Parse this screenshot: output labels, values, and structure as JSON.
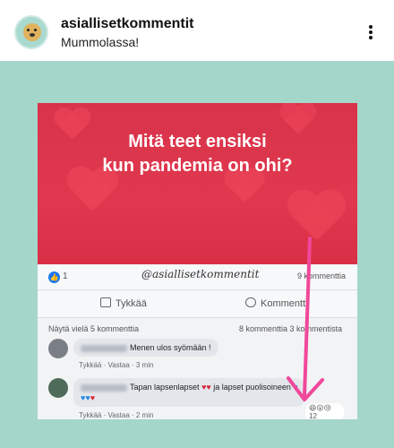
{
  "header": {
    "username": "asiallisetkommentit",
    "caption": "Mummolassa!",
    "avatar_icon": "dog-avatar",
    "more_icon": "more-vertical-icon"
  },
  "colors": {
    "background": "#a4d6c9",
    "banner_red": "#d8334a",
    "arrow_pink": "#f0489a",
    "facebook_blue": "#1877f2"
  },
  "fb_post": {
    "banner_line1": "Mitä teet ensiksi",
    "banner_line2": "kun pandemia on ohi?",
    "like_count": "1",
    "watermark": "@asiallisetkommentit",
    "comments_count": "9 kommenttia",
    "like_button": "Tykkää",
    "comment_button": "Kommentti",
    "more_comments": "Näytä vielä 5 kommenttia",
    "comments_of": "8 kommenttia 3 kommentista",
    "comments": [
      {
        "text": "Menen ulos syömään !",
        "like": "Tykkää",
        "reply": "Vastaa",
        "time": "3 min"
      },
      {
        "text_before": "Tapan lapsenlapset",
        "text_middle": "ja lapset puolisoineen",
        "like": "Tykkää",
        "reply": "Vastaa",
        "time": "2 min",
        "reaction_count": "12"
      }
    ]
  }
}
